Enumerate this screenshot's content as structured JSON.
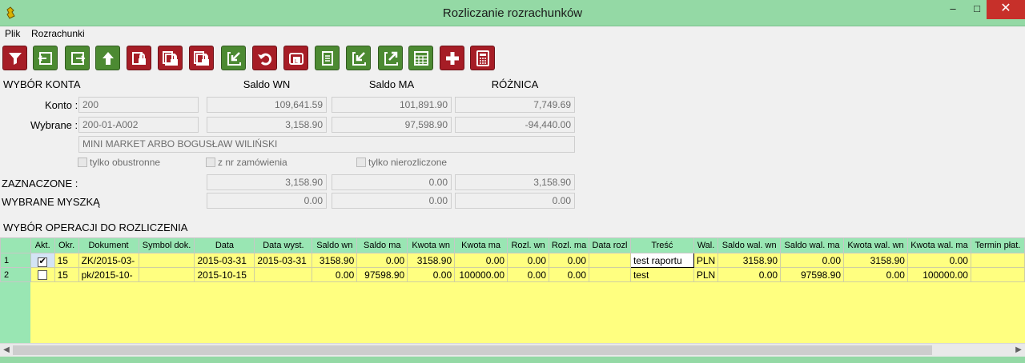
{
  "window": {
    "title": "Rozliczanie rozrachunków",
    "minimize": "–",
    "maximize": "□",
    "close": "✕"
  },
  "menu": [
    "Plik",
    "Rozrachunki"
  ],
  "toolbar": [
    {
      "icon": "filter-icon",
      "color": "r"
    },
    {
      "icon": "exit-left-icon",
      "color": "g"
    },
    {
      "icon": "exit-right-icon",
      "color": "g"
    },
    {
      "icon": "arrow-up-icon",
      "color": "g"
    },
    {
      "icon": "lock-icon",
      "color": "r"
    },
    {
      "icon": "lock-multi-icon",
      "color": "r"
    },
    {
      "icon": "lock-multi2-icon",
      "color": "r"
    },
    {
      "icon": "import-icon",
      "color": "g"
    },
    {
      "icon": "undo-icon",
      "color": "r"
    },
    {
      "icon": "print-icon",
      "color": "r"
    },
    {
      "icon": "document-icon",
      "color": "g"
    },
    {
      "icon": "import2-icon",
      "color": "g"
    },
    {
      "icon": "export-icon",
      "color": "g"
    },
    {
      "icon": "calendar-icon",
      "color": "g"
    },
    {
      "icon": "plus-icon",
      "color": "r"
    },
    {
      "icon": "calculator-icon",
      "color": "r"
    }
  ],
  "account": {
    "section_title": "WYBÓR KONTA",
    "col_wn": "Saldo WN",
    "col_ma": "Saldo MA",
    "col_diff": "RÓŻNICA",
    "konto_label": "Konto :",
    "konto_value": "200",
    "konto_wn": "109,641.59",
    "konto_ma": "101,891.90",
    "konto_diff": "7,749.69",
    "wybrane_label": "Wybrane :",
    "wybrane_value": "200-01-A002",
    "wybrane_wn": "3,158.90",
    "wybrane_ma": "97,598.90",
    "wybrane_diff": "-94,440.00",
    "name": "MINI MARKET ARBO BOGUSŁAW WILIŃSKI",
    "chk1": "tylko obustronne",
    "chk2": "z nr zamówienia",
    "chk3": "tylko nierozliczone",
    "zaz_label": "ZAZNACZONE :",
    "zaz_wn": "3,158.90",
    "zaz_ma": "0.00",
    "zaz_diff": "3,158.90",
    "mysz_label": "WYBRANE MYSZKĄ",
    "mysz_wn": "0.00",
    "mysz_ma": "0.00",
    "mysz_diff": "0.00"
  },
  "ops": {
    "section_title": "WYBÓR OPERACJI DO ROZLICZENIA",
    "columns": [
      "",
      "Akt.",
      "Okr.",
      "Dokument",
      "Symbol dok.",
      "Data",
      "Data wyst.",
      "Saldo wn",
      "Saldo ma",
      "Kwota wn",
      "Kwota ma",
      "Rozl. wn",
      "Rozl. ma",
      "Data rozl",
      "Treść",
      "Wal.",
      "Saldo wal. wn",
      "Saldo wal. ma",
      "Kwota wal. wn",
      "Kwota wal. ma",
      "Termin płat."
    ],
    "rows": [
      [
        "1",
        "✔",
        "15",
        "ZK/2015-03-",
        "",
        "2015-03-31",
        "2015-03-31",
        "3158.90",
        "0.00",
        "3158.90",
        "0.00",
        "0.00",
        "0.00",
        "",
        "test raportu",
        "PLN",
        "3158.90",
        "0.00",
        "3158.90",
        "0.00",
        ""
      ],
      [
        "2",
        "",
        "15",
        "pk/2015-10-",
        "",
        "2015-10-15",
        "",
        "0.00",
        "97598.90",
        "0.00",
        "100000.00",
        "0.00",
        "0.00",
        "",
        "test",
        "PLN",
        "0.00",
        "97598.90",
        "0.00",
        "100000.00",
        ""
      ]
    ]
  },
  "colors": {
    "title_bar": "#94d9a5",
    "grid_bg": "#ffff80",
    "grid_header": "#99e6b3",
    "btn_red": "#a61d26",
    "btn_green": "#4c8a32"
  }
}
